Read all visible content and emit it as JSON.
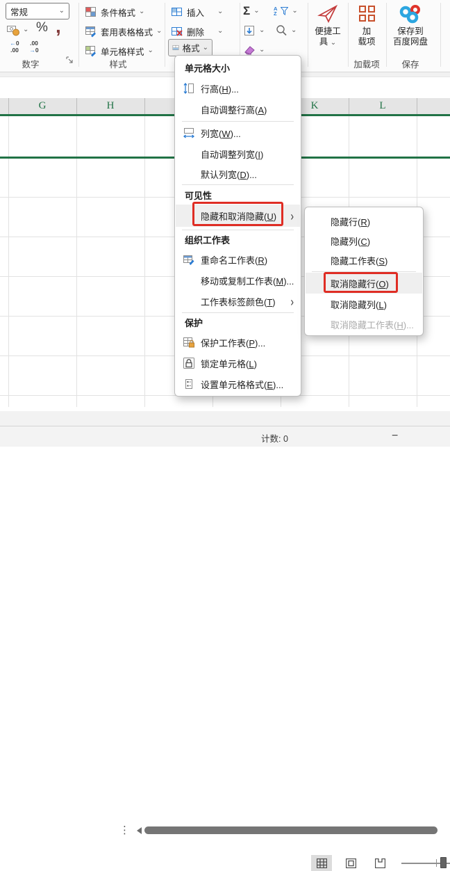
{
  "ribbon": {
    "number_format": "常规",
    "percent": "%",
    "comma": ",",
    "sum": "Σ",
    "decimal_inc": {
      "arrow": "←",
      "num": "0",
      "line2": ".00"
    },
    "decimal_dec": {
      "line1": ".00",
      "arrow": "→",
      "num": "0"
    },
    "groups": {
      "number": "数字",
      "style": "样式",
      "addins": "加载项",
      "save": "保存"
    },
    "style": {
      "conditional": "条件格式",
      "table": "套用表格格式",
      "cell": "单元格样式"
    },
    "cells": {
      "insert": "插入",
      "delete": "删除",
      "format": "格式"
    },
    "quick_tools": {
      "line1": "便捷工",
      "line2": "具"
    },
    "addins_btn": {
      "line1": "加",
      "line2": "载项"
    },
    "baidu_btn": {
      "line1": "保存到",
      "line2": "百度网盘"
    }
  },
  "grid": {
    "columns": {
      "g": "G",
      "h": "H",
      "k": "K",
      "l": "L"
    }
  },
  "format_menu": {
    "headers": {
      "cell_size": "单元格大小",
      "visibility": "可见性",
      "organize": "组织工作表",
      "protect": "保护"
    },
    "items": {
      "row_height": {
        "pre": "行高(",
        "key": "H",
        "post": ")..."
      },
      "autofit_row": {
        "pre": "自动调整行高(",
        "key": "A",
        "post": ")"
      },
      "col_width": {
        "pre": "列宽(",
        "key": "W",
        "post": ")..."
      },
      "autofit_col": {
        "pre": "自动调整列宽(",
        "key": "I",
        "post": ")"
      },
      "default_width": {
        "pre": "默认列宽(",
        "key": "D",
        "post": ")..."
      },
      "hide_unhide": {
        "pre": "隐藏和取消隐藏(",
        "key": "U",
        "post": ")"
      },
      "rename_sheet": {
        "pre": "重命名工作表(",
        "key": "R",
        "post": ")"
      },
      "move_copy": {
        "pre": "移动或复制工作表(",
        "key": "M",
        "post": ")..."
      },
      "tab_color": {
        "pre": "工作表标签颜色(",
        "key": "T",
        "post": ")"
      },
      "protect_sheet": {
        "pre": "保护工作表(",
        "key": "P",
        "post": ")..."
      },
      "lock_cell": {
        "pre": "锁定单元格(",
        "key": "L",
        "post": ")"
      },
      "format_cells": {
        "pre": "设置单元格格式(",
        "key": "E",
        "post": ")..."
      }
    }
  },
  "hide_submenu": {
    "hide_rows": {
      "pre": "隐藏行(",
      "key": "R",
      "post": ")"
    },
    "hide_cols": {
      "pre": "隐藏列(",
      "key": "C",
      "post": ")"
    },
    "hide_sheet": {
      "pre": "隐藏工作表(",
      "key": "S",
      "post": ")"
    },
    "unhide_rows": {
      "pre": "取消隐藏行(",
      "key": "O",
      "post": ")"
    },
    "unhide_cols": {
      "pre": "取消隐藏列(",
      "key": "L",
      "post": ")"
    },
    "unhide_sheet": {
      "pre": "取消隐藏工作表(",
      "key": "H",
      "post": ")..."
    }
  },
  "status_bar": {
    "count": "计数: 0"
  },
  "colors": {
    "excel_green": "#217346",
    "highlight_red": "#DF2D24",
    "accent_blue": "#2B7CD3"
  }
}
